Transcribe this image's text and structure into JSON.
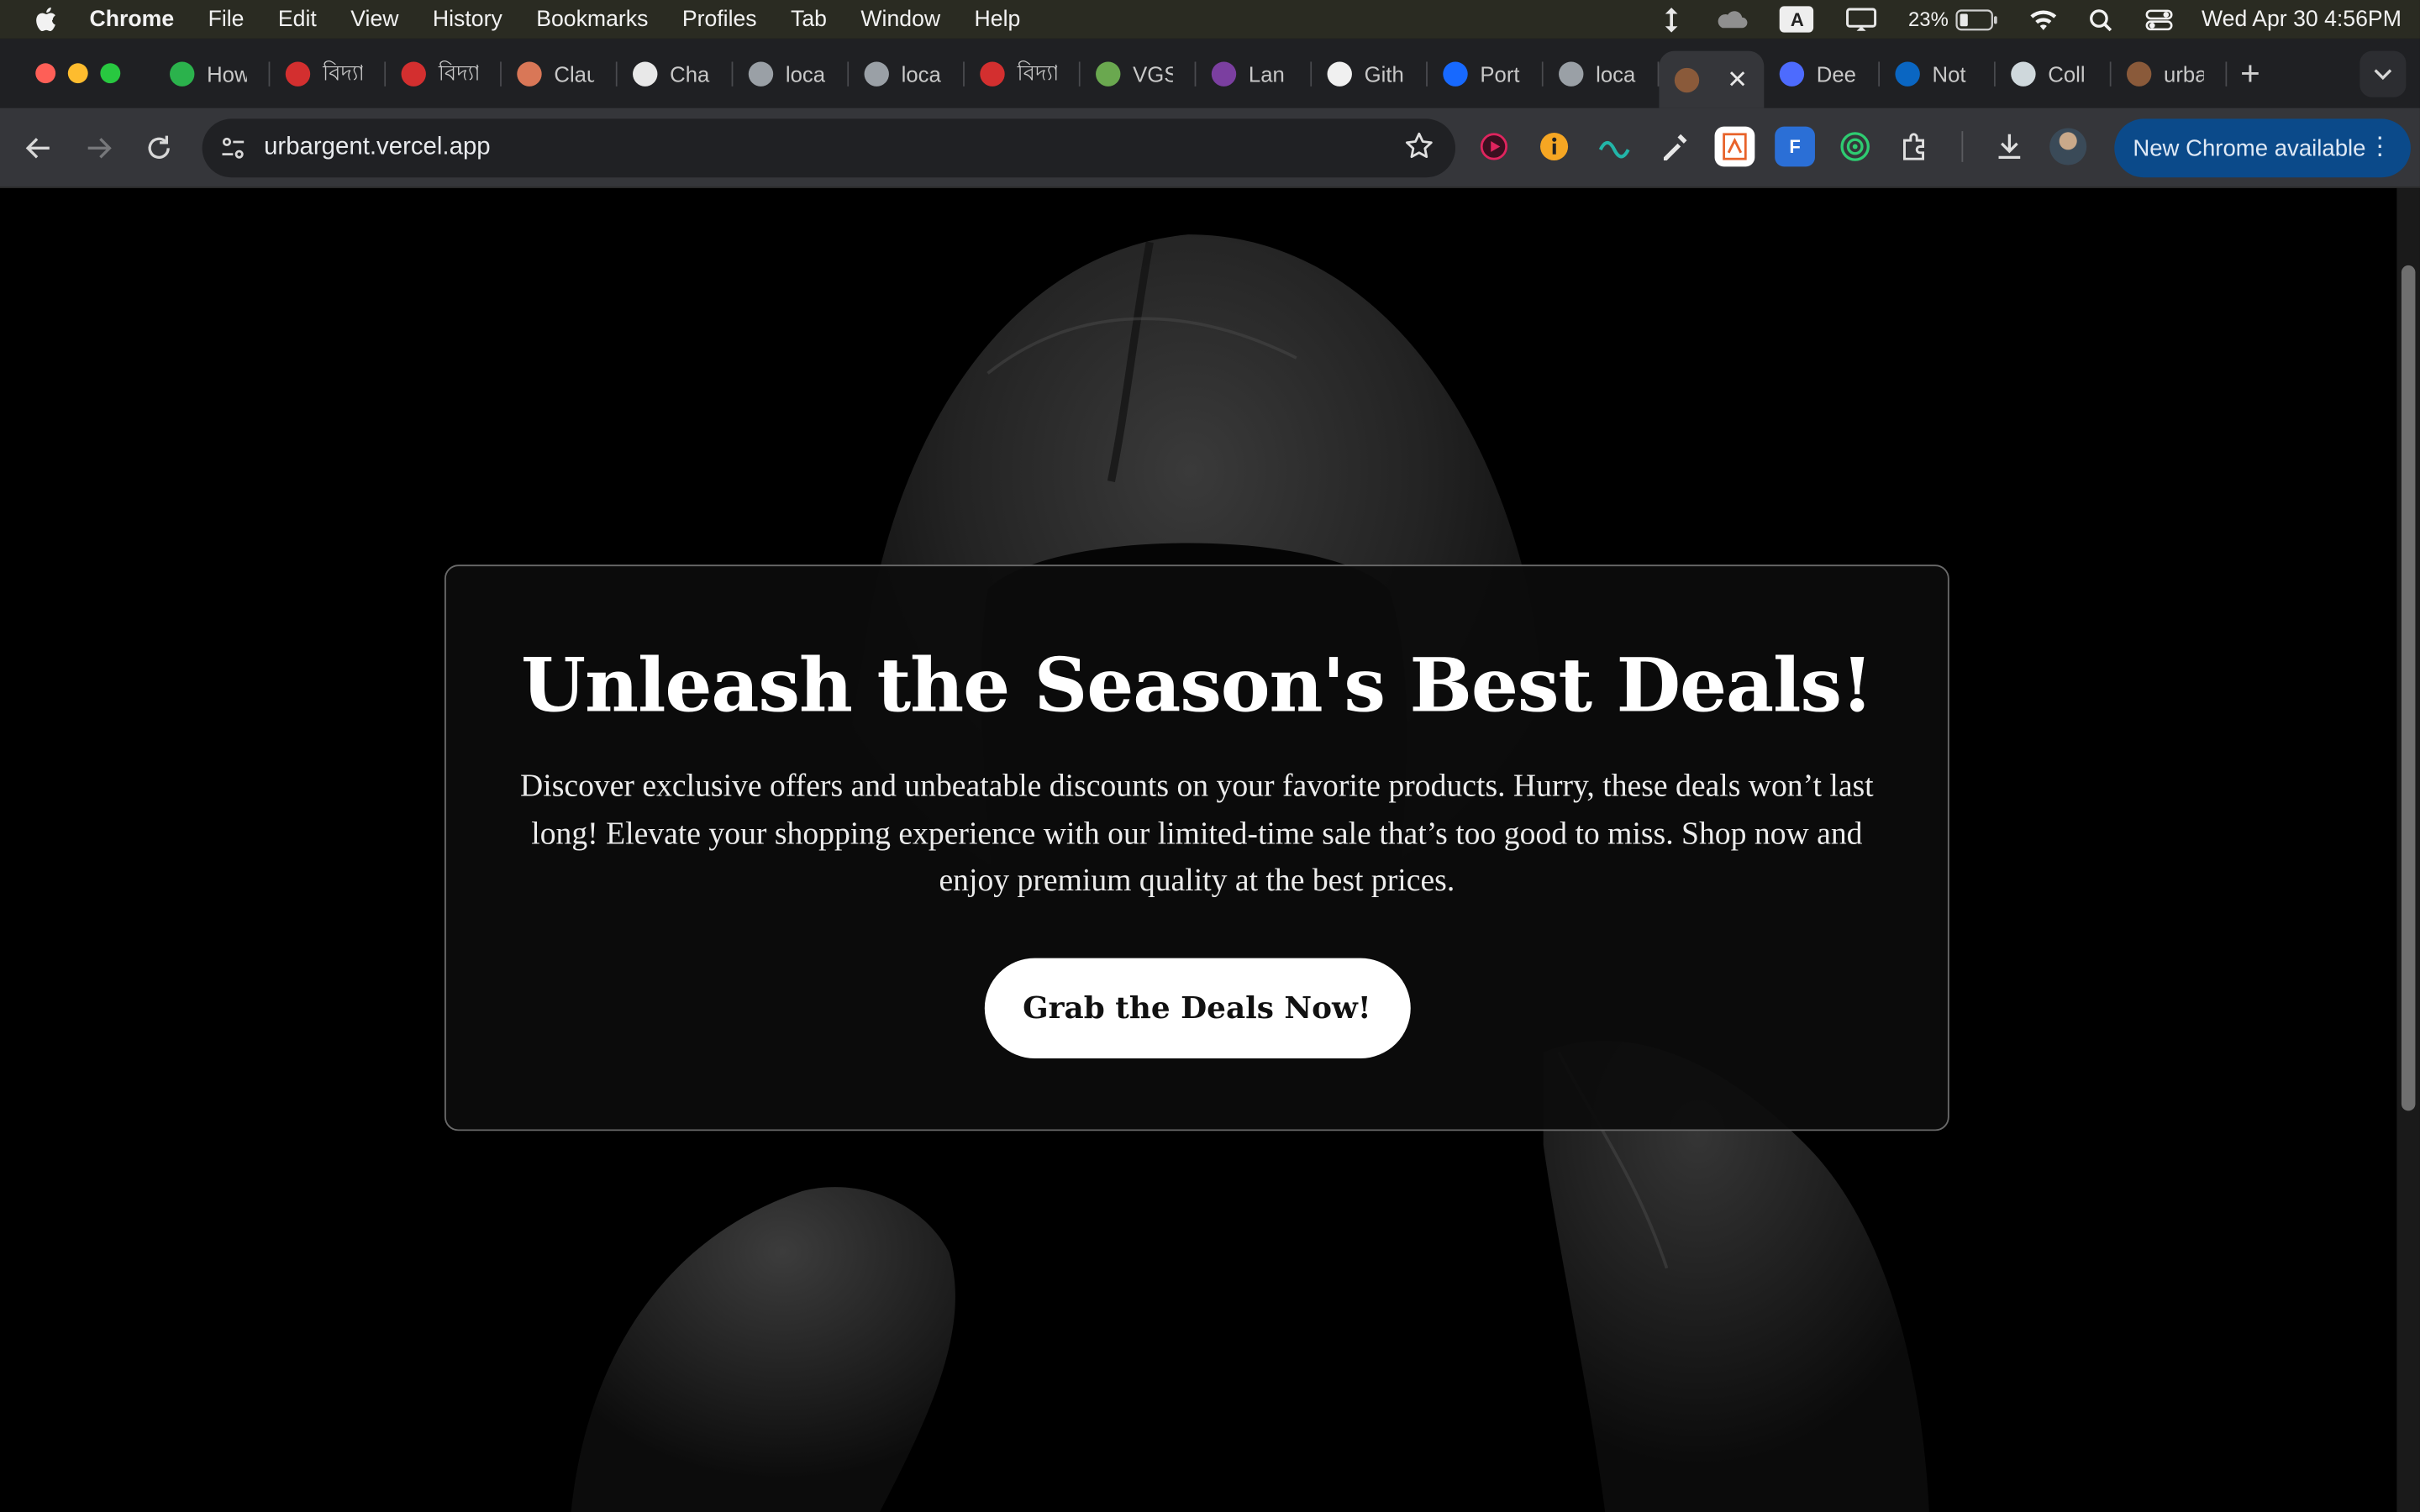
{
  "menubar": {
    "app": "Chrome",
    "items": [
      "File",
      "Edit",
      "View",
      "History",
      "Bookmarks",
      "Profiles",
      "Tab",
      "Window",
      "Help"
    ],
    "battery": "23%",
    "datetime": "Wed Apr 30  4:56PM"
  },
  "tabs": [
    {
      "label": "How",
      "color": "#2bb24c"
    },
    {
      "label": "বিদ্যা",
      "color": "#d32f2f"
    },
    {
      "label": "বিদ্যা",
      "color": "#d32f2f"
    },
    {
      "label": "Clau",
      "color": "#d97757"
    },
    {
      "label": "Cha",
      "color": "#e8e8e8"
    },
    {
      "label": "loca",
      "color": "#9aa0a6"
    },
    {
      "label": "loca",
      "color": "#9aa0a6"
    },
    {
      "label": "বিদ্যা",
      "color": "#d32f2f"
    },
    {
      "label": "VGS",
      "color": "#6aa84f"
    },
    {
      "label": "Lan",
      "color": "#7b3fa0"
    },
    {
      "label": "Gith",
      "color": "#f0f0f0"
    },
    {
      "label": "Port",
      "color": "#1769ff"
    },
    {
      "label": "loca",
      "color": "#9aa0a6"
    },
    {
      "label": "",
      "color": "#8a5a3a",
      "active": true
    },
    {
      "label": "Dee",
      "color": "#4d6bfe"
    },
    {
      "label": "Not",
      "color": "#0a66c2"
    },
    {
      "label": "Coll",
      "color": "#cfd8dc"
    },
    {
      "label": "urba",
      "color": "#8a5a3a"
    }
  ],
  "toolbar": {
    "url": "urbargent.vercel.app",
    "new_chrome": "New Chrome available"
  },
  "hero": {
    "title": "Unleash the Season's Best Deals!",
    "body": "Discover exclusive offers and unbeatable discounts on your favorite products. Hurry, these deals won’t last long! Elevate your shopping experience with our limited-time sale that’s too good to miss. Shop now and enjoy premium quality at the best prices.",
    "cta": "Grab the Deals Now!"
  }
}
